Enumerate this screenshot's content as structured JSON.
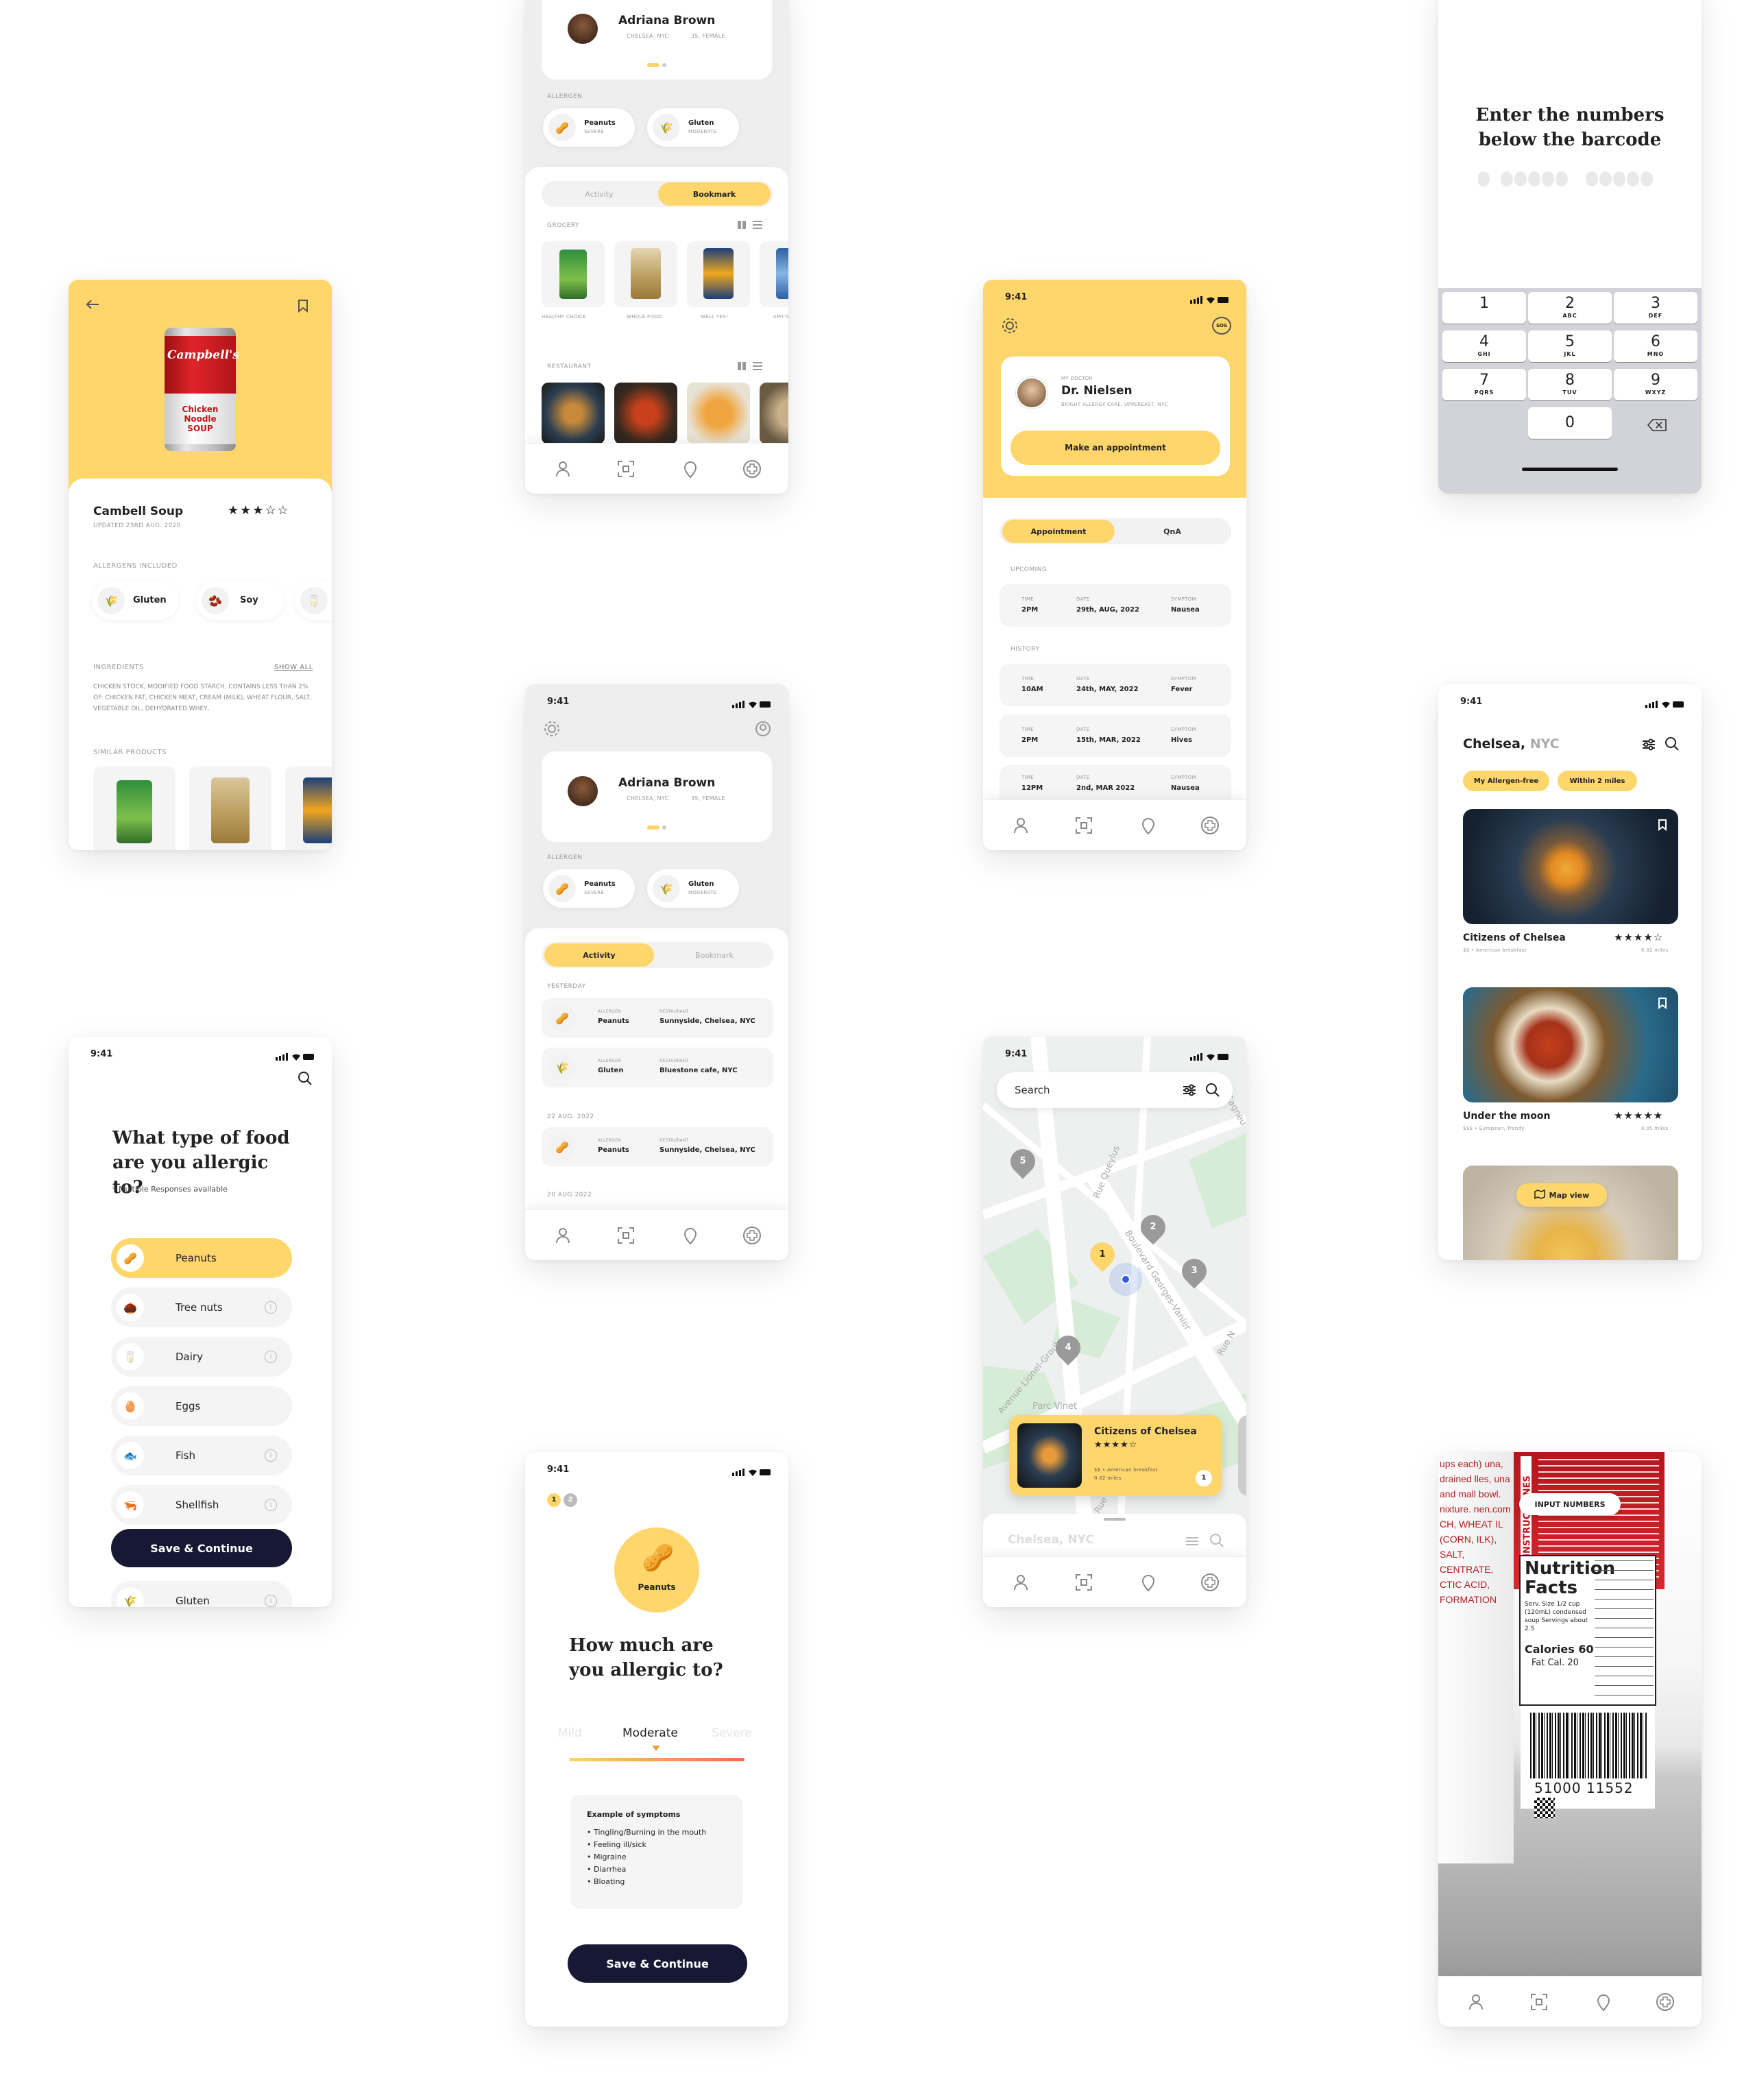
{
  "status_time": "9:41",
  "colors": {
    "accent": "#FFD66B",
    "dark": "#171833",
    "bg_gray": "#EEEEEE"
  },
  "product": {
    "name": "Cambell Soup",
    "updated": "UPDATED 23RD AUG. 2020",
    "rating": "★★★☆☆",
    "allergens_title": "ALLERGENS INCLUDED",
    "allergens": [
      "Gluten",
      "Soy"
    ],
    "ingredients_title": "INGREDIENTS",
    "show_all": "SHOW ALL",
    "ingredients_text": "CHICKEN STOCK, MODIFIED FOOD STARCH, CONTAINS LESS THAN 2% OF: CHICKEN FAT, CHICKEN MEAT, CREAM (MILK), WHEAT FLOUR, SALT, VEGETABLE OIL, DEHYDRATED WHEY,",
    "similar_title": "SIMILAR PRODUCTS",
    "can_label": "Campbell's",
    "can_sub": "Chicken Noodle SOUP"
  },
  "profile": {
    "name": "Adriana Brown",
    "location": "CHELSEA, NYC",
    "gender": "35, FEMALE",
    "allergen_title": "ALLERGEN",
    "allergens": [
      {
        "name": "Peanuts",
        "level": "SEVERE"
      },
      {
        "name": "Gluten",
        "level": "MODERATE"
      }
    ],
    "tabs": [
      "Activity",
      "Bookmark"
    ],
    "grocery_title": "GROCERY",
    "grocery": [
      "HEALTHY CHOICE",
      "WHOLE FOOD",
      "WELL YES!",
      "AMY'S"
    ],
    "restaurant_title": "RESTAURANT",
    "activity": {
      "groups": [
        {
          "date": "YESTERDAY",
          "items": [
            {
              "allergen": "Peanuts",
              "restaurant": "Sunnyside, Chelsea, NYC"
            },
            {
              "allergen": "Gluten",
              "restaurant": "Bluestone cafe, NYC"
            }
          ]
        },
        {
          "date": "22 AUG. 2022",
          "items": [
            {
              "allergen": "Peanuts",
              "restaurant": "Sunnyside, Chelsea, NYC"
            }
          ]
        },
        {
          "date": "20 AUG 2022",
          "items": []
        }
      ],
      "allergen_label": "ALLERGEN",
      "restaurant_label": "RESTAURANT"
    }
  },
  "doctor": {
    "caption": "MY DOCTOR",
    "name": "Dr. Nielsen",
    "address": "BRIGHT ALLERGY CARE, UPPEREAST, NYC",
    "button": "Make an appointment",
    "sos": "SOS",
    "tabs": [
      "Appointment",
      "QnA"
    ],
    "upcoming_title": "UPCOMING",
    "history_title": "HISTORY",
    "col_time": "TIME",
    "col_date": "DATE",
    "col_symptom": "SYMPTOM",
    "upcoming": [
      {
        "time": "2PM",
        "date": "29th, AUG, 2022",
        "symptom": "Nausea"
      }
    ],
    "history": [
      {
        "time": "10AM",
        "date": "24th, MAY, 2022",
        "symptom": "Fever"
      },
      {
        "time": "2PM",
        "date": "15th, MAR, 2022",
        "symptom": "Hives"
      },
      {
        "time": "12PM",
        "date": "2nd, MAR 2022",
        "symptom": "Nausea"
      }
    ]
  },
  "barcode_entry": {
    "title": "Enter the numbers below the barcode",
    "keys": [
      {
        "n": "1",
        "l": ""
      },
      {
        "n": "2",
        "l": "ABC"
      },
      {
        "n": "3",
        "l": "DEF"
      },
      {
        "n": "4",
        "l": "GHI"
      },
      {
        "n": "5",
        "l": "JKL"
      },
      {
        "n": "6",
        "l": "MNO"
      },
      {
        "n": "7",
        "l": "PQRS"
      },
      {
        "n": "8",
        "l": "TUV"
      },
      {
        "n": "9",
        "l": "WXYZ"
      },
      {
        "n": "0",
        "l": ""
      }
    ]
  },
  "allergy_select": {
    "title": "What type of food are you allergic to?",
    "note": "* Multiple Responses available",
    "options": [
      "Peanuts",
      "Tree nuts",
      "Dairy",
      "Eggs",
      "Fish",
      "Shellfish",
      "Gluten"
    ],
    "button": "Save & Continue"
  },
  "severity": {
    "steps": [
      "1",
      "2"
    ],
    "badge": "Peanuts",
    "title": "How much are you allergic to?",
    "levels": [
      "Mild",
      "Moderate",
      "Severe"
    ],
    "symptoms_title": "Example of symptoms",
    "symptoms": [
      "Tingling/Burning in the mouth",
      "Feeling ill/sick",
      "Migraine",
      "Diarrhea",
      "Bloating"
    ],
    "button": "Save & Continue"
  },
  "map": {
    "search_placeholder": "Search",
    "pins": [
      "5",
      "2",
      "1",
      "3",
      "4"
    ],
    "streets": [
      "Rue Queylus",
      "Boulevard Georges-Vanier",
      "Avenue Lionel-Groulx",
      "Parc Vinet",
      "Rue N",
      "Rue",
      "Sagneu"
    ],
    "card": {
      "name": "Citizens of Chelsea",
      "rating": "★★★★☆",
      "meta": "$$ • American breakfast",
      "distance": "0.02 miles",
      "badge": "1"
    },
    "sheet_title": "Chelsea, NYC"
  },
  "restaurants": {
    "location": "Chelsea,",
    "location_sub": "NYC",
    "filters": [
      "My Allergen-free",
      "Within 2 miles"
    ],
    "items": [
      {
        "name": "Citizens of Chelsea",
        "rating": "★★★★☆",
        "meta": "$$ • American breakfast",
        "distance": "0.02 miles"
      },
      {
        "name": "Under the moon",
        "rating": "★★★★★",
        "meta": "$$$ • European, Trendy",
        "distance": "0.05 miles"
      }
    ],
    "map_view": "Map view"
  },
  "scan": {
    "input_button": "INPUT NUMBERS",
    "label_heading": "Nutrition Facts",
    "serv": "Serv. Size 1/2 cup (120mL) condensed soup Servings about 2.5",
    "calories": "Calories 60",
    "fat_cal": "Fat Cal. 20",
    "barcode_digits": "51000 11552",
    "side_text": "INSTRUCCIONES",
    "left_text": "ups each) una, drained lles, una and mall bowl. nixture. nen.com CH, WHEAT IL (CORN, ILK), SALT, CENTRATE, CTIC ACID, FORMATION"
  }
}
